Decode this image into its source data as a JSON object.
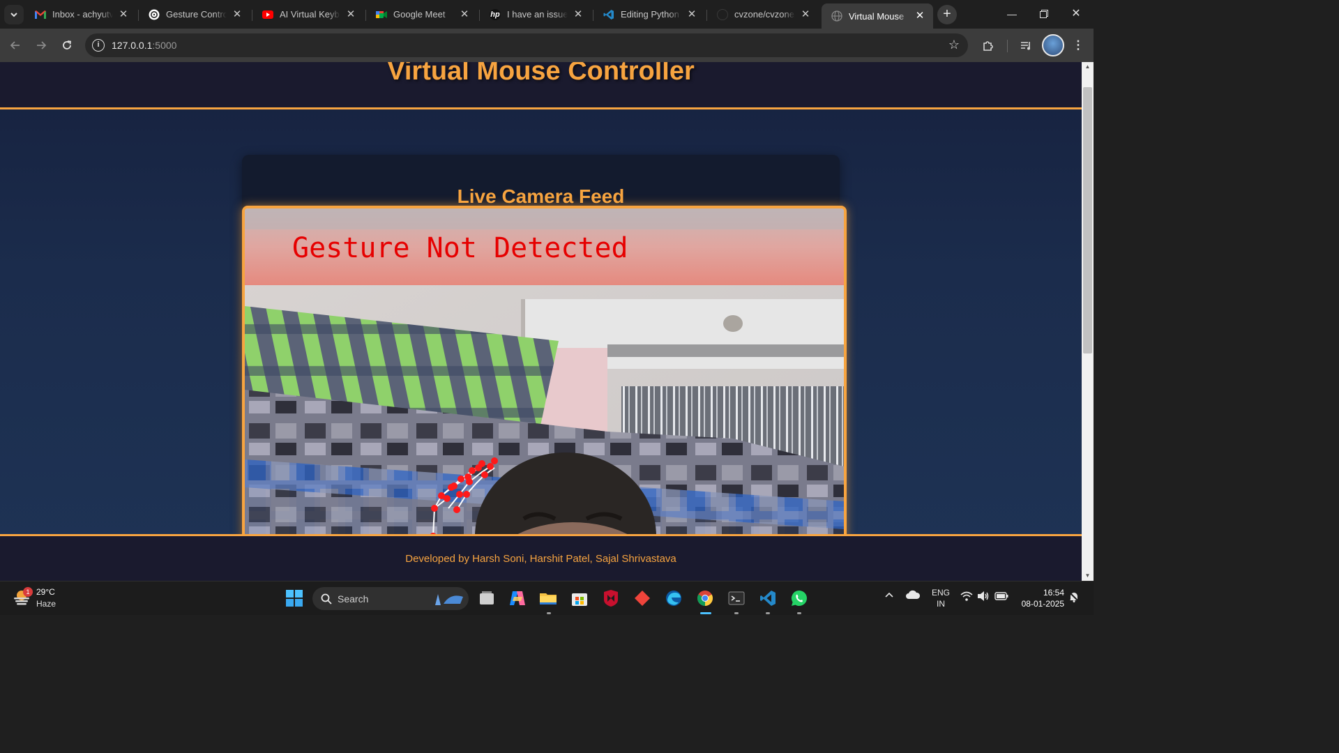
{
  "browser": {
    "tabs": [
      {
        "title": "Inbox - achyutve",
        "icon": "gmail-icon"
      },
      {
        "title": "Gesture Control",
        "icon": "chatgpt-icon"
      },
      {
        "title": "AI Virtual Keyboa",
        "icon": "youtube-icon"
      },
      {
        "title": "Google Meet",
        "icon": "google-meet-icon"
      },
      {
        "title": "I have an issue w",
        "icon": "hp-icon"
      },
      {
        "title": "Editing Python C",
        "icon": "vscode-icon"
      },
      {
        "title": "cvzone/cvzone/l",
        "icon": "github-icon"
      },
      {
        "title": "Virtual Mouse",
        "icon": "globe-icon",
        "active": true
      }
    ],
    "url_host": "127.0.0.1",
    "url_port": ":5000"
  },
  "page": {
    "title": "Virtual Mouse Controller",
    "card_title": "Live Camera Feed",
    "overlay_text": "Gesture Not Detected",
    "footer": "Developed by Harsh Soni, Harshit Patel, Sajal Shrivastava",
    "accent_color": "#f7a440"
  },
  "taskbar": {
    "weather_temp": "29°C",
    "weather_desc": "Haze",
    "weather_badge": "1",
    "search_label": "Search",
    "lang_top": "ENG",
    "lang_bottom": "IN",
    "time": "16:54",
    "date": "08-01-2025"
  }
}
